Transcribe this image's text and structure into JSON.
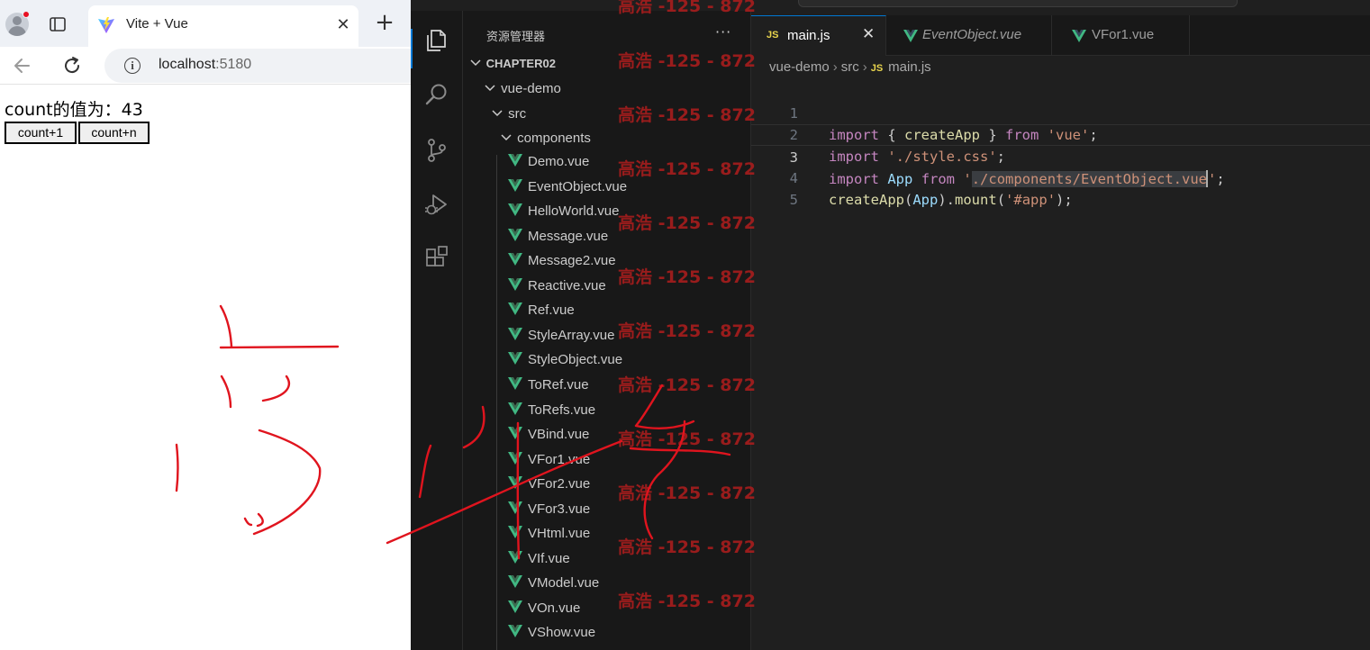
{
  "browser": {
    "tab_title": "Vite + Vue",
    "tab_close": "✕",
    "new_tab": "+",
    "url_host": "localhost",
    "url_port": ":5180",
    "page": {
      "count_label": "count的值为：43",
      "buttons": [
        "count+1",
        "count+n"
      ]
    }
  },
  "vscode": {
    "explorer": {
      "title": "资源管理器",
      "more": "···",
      "folders": [
        "CHAPTER02",
        "vue-demo",
        "src",
        "components"
      ],
      "files": [
        "Demo.vue",
        "EventObject.vue",
        "HelloWorld.vue",
        "Message.vue",
        "Message2.vue",
        "Reactive.vue",
        "Ref.vue",
        "StyleArray.vue",
        "StyleObject.vue",
        "ToRef.vue",
        "ToRefs.vue",
        "VBind.vue",
        "VFor1.vue",
        "VFor2.vue",
        "VFor3.vue",
        "VHtml.vue",
        "VIf.vue",
        "VModel.vue",
        "VOn.vue",
        "VShow.vue"
      ]
    },
    "tabs": [
      {
        "badge": "JS",
        "label": "main.js",
        "close": "✕"
      },
      {
        "label": "EventObject.vue"
      },
      {
        "label": "VFor1.vue"
      }
    ],
    "breadcrumb": [
      "vue-demo",
      "src",
      "main.js"
    ],
    "breadcrumb_badge": "JS",
    "editor": {
      "line_numbers": [
        "1",
        "2",
        "3",
        "4",
        "5"
      ],
      "l1": {
        "kw1": "import",
        "p1": " { ",
        "fn": "createApp",
        "p2": " } ",
        "kw2": "from",
        "sp": " ",
        "str": "'vue'",
        "end": ";"
      },
      "l2": {
        "kw": "import",
        "sp": " ",
        "str": "'./style.css'",
        "end": ";"
      },
      "l3": {
        "kw1": "import",
        "sp1": " ",
        "var": "App",
        "sp2": " ",
        "kw2": "from",
        "sp3": " ",
        "q1": "'",
        "path": "./components/EventObject.vue",
        "q2": "'",
        "end": ";"
      },
      "l4": {
        "fn1": "createApp",
        "p1": "(",
        "var": "App",
        "p2": ").",
        "fn2": "mount",
        "p3": "(",
        "str": "'#app'",
        "p4": ");"
      }
    },
    "watermark": "高浩 -125 - 872"
  },
  "colors": {
    "editor_bg": "#1f1f1f",
    "sidebar_bg": "#181818",
    "keyword": "#c586c0",
    "function": "#dcdcaa",
    "variable": "#9cdcfe",
    "string": "#ce9178",
    "vue_green": "#41b883",
    "watermark": "#a51d1d",
    "ink": "#e0141e"
  }
}
